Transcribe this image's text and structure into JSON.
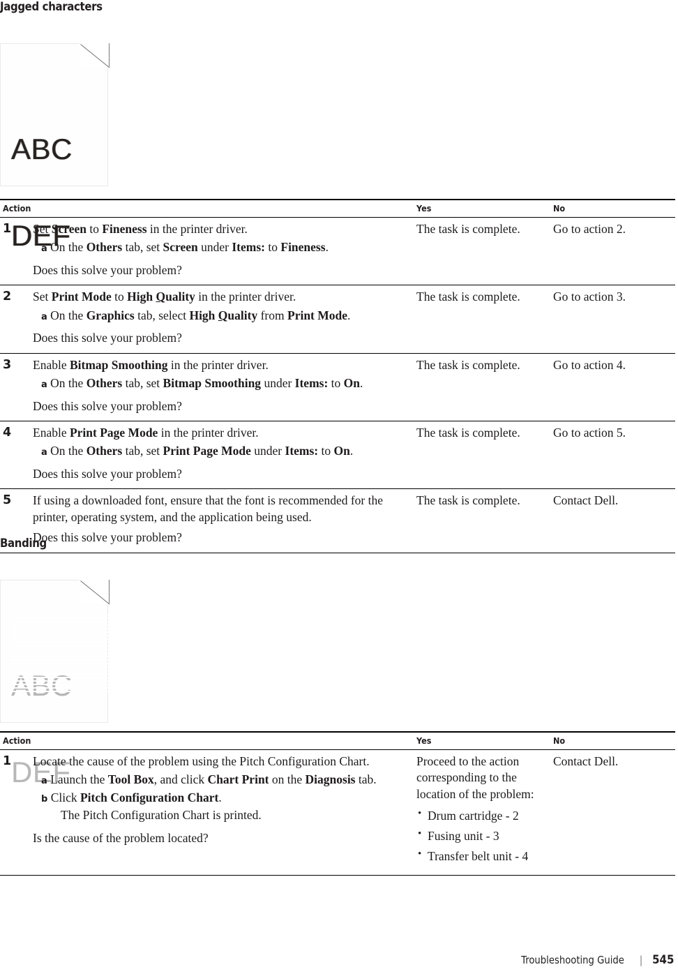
{
  "sections": [
    {
      "heading": "Jagged characters",
      "illustration": {
        "name": "printed-page-sample-jagged",
        "line1": "ABC",
        "line2": "DEF",
        "defect": "jagged"
      }
    },
    {
      "heading": "Banding",
      "illustration": {
        "name": "printed-page-sample-banding",
        "line1": "ABC",
        "line2": "DEF",
        "defect": "banding"
      }
    }
  ],
  "table_jagged": {
    "headers": {
      "action": "Action",
      "yes": "Yes",
      "no": "No"
    },
    "rows": [
      {
        "num": "1",
        "main_prefix": "Set ",
        "main_b1": "Screen",
        "main_mid1": " to ",
        "main_b2": "Fineness",
        "main_suffix": " in the printer driver.",
        "sub_label": "a",
        "sub_p1": "On the ",
        "sub_b1": "Others",
        "sub_p2": " tab, set ",
        "sub_b2": "Screen",
        "sub_p3": " under ",
        "sub_b3": "Items:",
        "sub_p4": " to ",
        "sub_b4": "Fineness",
        "sub_p5": ".",
        "question": "Does this solve your problem?",
        "yes": "The task is complete.",
        "no": "Go to action 2."
      },
      {
        "num": "2",
        "main_prefix": "Set ",
        "main_b1": "Print Mode",
        "main_mid1": " to ",
        "main_b2": "High Quality",
        "main_b2_mnemonic": "Q",
        "main_suffix": " in the printer driver.",
        "sub_label": "a",
        "sub_p1": "On the ",
        "sub_b1": "Graphics",
        "sub_p2": " tab, select ",
        "sub_b2": "High Quality",
        "sub_b2_mnemonic": "Q",
        "sub_p3": " from ",
        "sub_b3": "Print Mode",
        "sub_p4": ".",
        "question": "Does this solve your problem?",
        "yes": "The task is complete.",
        "no": "Go to action 3."
      },
      {
        "num": "3",
        "main_prefix": "Enable ",
        "main_b1": "Bitmap Smoothing",
        "main_suffix": " in the printer driver.",
        "sub_label": "a",
        "sub_p1": "On the ",
        "sub_b1": "Others",
        "sub_p2": " tab, set ",
        "sub_b2": "Bitmap Smoothing",
        "sub_p3": " under ",
        "sub_b3": "Items:",
        "sub_p4": " to ",
        "sub_b4": "On",
        "sub_p5": ".",
        "question": "Does this solve your problem?",
        "yes": "The task is complete.",
        "no": "Go to action 4."
      },
      {
        "num": "4",
        "main_prefix": "Enable ",
        "main_b1": "Print Page Mode",
        "main_suffix": " in the printer driver.",
        "sub_label": "a",
        "sub_p1": "On the ",
        "sub_b1": "Others",
        "sub_p2": " tab, set ",
        "sub_b2": "Print Page Mode",
        "sub_p3": " under ",
        "sub_b3": "Items:",
        "sub_p4": " to ",
        "sub_b4": "On",
        "sub_p5": ".",
        "question": "Does this solve your problem?",
        "yes": "The task is complete.",
        "no": "Go to action 5."
      },
      {
        "num": "5",
        "main_plain": "If using a downloaded font, ensure that the font is recommended for the printer, operating system, and the application being used.",
        "question": "Does this solve your problem?",
        "yes": "The task is complete.",
        "no": "Contact Dell."
      }
    ]
  },
  "table_banding": {
    "headers": {
      "action": "Action",
      "yes": "Yes",
      "no": "No"
    },
    "row": {
      "num": "1",
      "main_plain": "Locate the cause of the problem using the Pitch Configuration Chart.",
      "sub_a_label": "a",
      "sub_a_p1": "Launch the ",
      "sub_a_b1": "Tool Box",
      "sub_a_p2": ", and click ",
      "sub_a_b2": "Chart Print",
      "sub_a_p3": " on the ",
      "sub_a_b3": "Diagnosis",
      "sub_a_p4": " tab.",
      "sub_b_label": "b",
      "sub_b_p1": "Click ",
      "sub_b_b1": "Pitch Configuration Chart",
      "sub_b_p2": ".",
      "sub_note": "The Pitch Configuration Chart is printed.",
      "question": "Is the cause of the problem located?",
      "yes_intro": "Proceed to the action corresponding to the location of the problem:",
      "yes_list": [
        "Drum cartridge - 2",
        "Fusing unit - 3",
        "Transfer belt unit - 4"
      ],
      "no": "Contact Dell."
    }
  },
  "footer": {
    "guide_title": "Troubleshooting Guide",
    "separator": "|",
    "page_number": "545"
  }
}
